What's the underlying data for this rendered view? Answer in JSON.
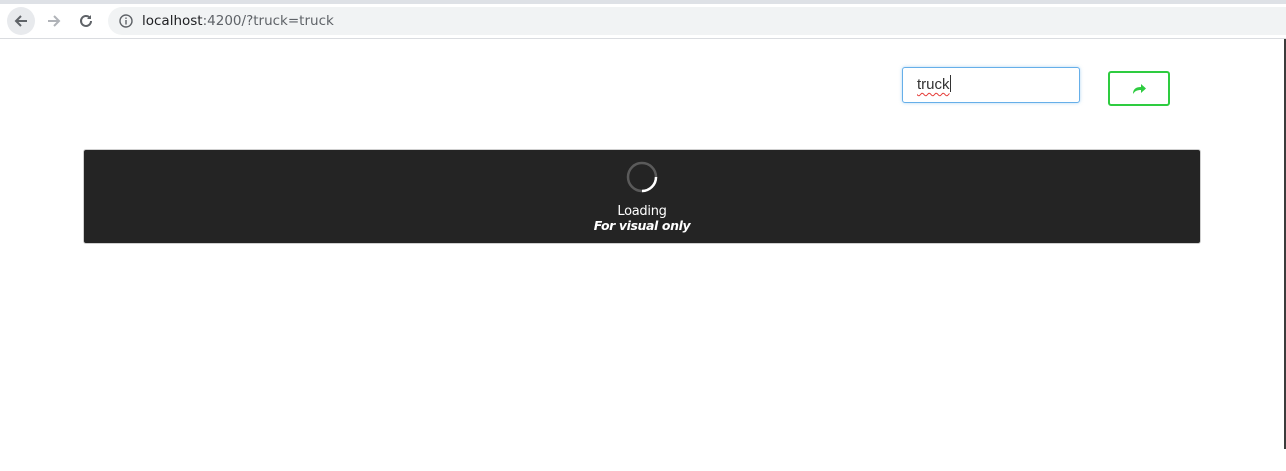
{
  "browser": {
    "url_host": "localhost",
    "url_rest": ":4200/?truck=truck"
  },
  "search": {
    "value": "truck"
  },
  "loading": {
    "label": "Loading",
    "sublabel": "For visual only"
  },
  "colors": {
    "panel_bg": "#242424",
    "accent_green": "#2ecc40",
    "input_focus_border": "#66afe9"
  },
  "icons": {
    "back": "arrow-left-icon",
    "forward": "arrow-right-icon",
    "reload": "reload-icon",
    "info": "info-icon",
    "go": "share-arrow-icon",
    "spinner": "spinner-icon"
  }
}
